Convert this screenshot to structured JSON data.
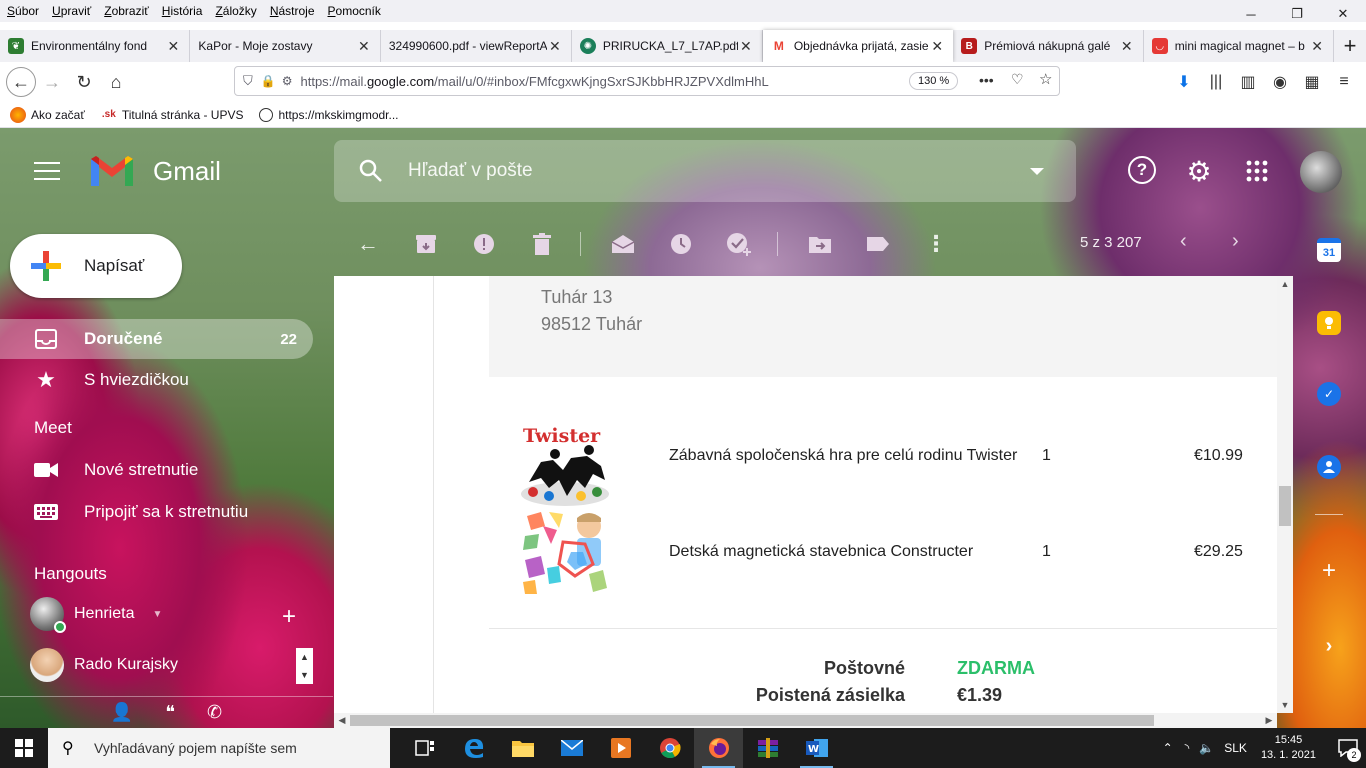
{
  "menu": [
    "Súbor",
    "Upraviť",
    "Zobraziť",
    "História",
    "Záložky",
    "Nástroje",
    "Pomocník"
  ],
  "tabs": [
    {
      "title": "Environmentálny fond",
      "favicon": "green-leaf-icon",
      "color": "#2e7d32"
    },
    {
      "title": "KaPor - Moje zostavy",
      "favicon": "none",
      "color": "#ffffff"
    },
    {
      "title": "324990600.pdf - viewReportA",
      "favicon": "none",
      "color": "#ffffff"
    },
    {
      "title": "PRIRUCKA_L7_L7AP.pdf",
      "favicon": "globe-icon",
      "color": "#1b7f5a"
    },
    {
      "title": "Objednávka prijatá, zasie",
      "favicon": "gmail-icon",
      "color": "#ea4335"
    },
    {
      "title": "Prémiová nákupná galé",
      "favicon": "b-icon",
      "color": "#b71c1c"
    },
    {
      "title": "mini magical magnet – b",
      "favicon": "shop-icon",
      "color": "#e53935"
    }
  ],
  "active_tab_index": 4,
  "url": {
    "prefix": "https://mail.",
    "host": "google.com",
    "suffix": "/mail/u/0/#inbox/FMfcgxwKjngSxrSJKbbHRJZPVXdlmHhL",
    "zoom": "130 %"
  },
  "bookmarks": [
    {
      "label": "Ako začať",
      "icon": "firefox-icon"
    },
    {
      "label": "Titulná stránka - UPVS",
      "icon": "sk-icon"
    },
    {
      "label": "https://mkskimgmodr...",
      "icon": "globe-icon"
    }
  ],
  "gmail": {
    "brand": "Gmail",
    "search_placeholder": "Hľadať v pošte",
    "compose_label": "Napísať",
    "nav": [
      {
        "label": "Doručené",
        "count": "22",
        "icon": "inbox-icon"
      },
      {
        "label": "S hviezdičkou",
        "count": "",
        "icon": "star-icon"
      }
    ],
    "meet_title": "Meet",
    "meet_items": [
      {
        "label": "Nové stretnutie",
        "icon": "video-icon"
      },
      {
        "label": "Pripojiť sa k stretnutiu",
        "icon": "keyboard-icon"
      }
    ],
    "hangouts_title": "Hangouts",
    "hangouts": [
      {
        "name": "Henrieta",
        "online": true
      },
      {
        "name": "Rado Kurajsky",
        "online": false
      }
    ],
    "pager": "5 z 3 207"
  },
  "email": {
    "address_lines": [
      "Tuhár 13",
      "98512 Tuhár"
    ],
    "items": [
      {
        "name": "Zábavná spoločenská hra pre celú rodinu Twister",
        "qty": "1",
        "price": "€10.99",
        "image_text": "Twister"
      },
      {
        "name": "Detská magnetická stavebnica Constructer",
        "qty": "1",
        "price": "€29.25",
        "image_text": ""
      }
    ],
    "summary": [
      {
        "label": "Poštovné",
        "value": "ZDARMA",
        "color": "#2bbf6a"
      },
      {
        "label": "Poistená zásielka",
        "value": "€1.39",
        "color": "#333333"
      }
    ]
  },
  "taskbar": {
    "search_placeholder": "Vyhľadávaný pojem napíšte sem",
    "language": "SLK",
    "time": "15:45",
    "date": "13. 1. 2021",
    "notifications": "2"
  }
}
